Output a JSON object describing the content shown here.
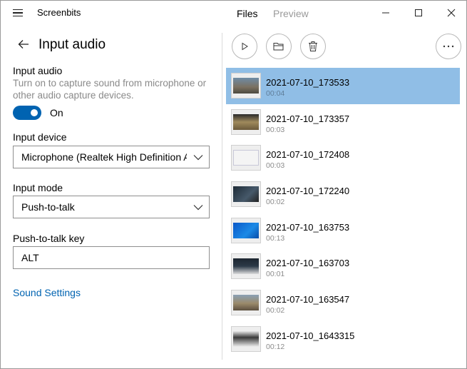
{
  "app": {
    "title": "Screenbits"
  },
  "nav": {
    "files": "Files",
    "preview": "Preview"
  },
  "panel": {
    "title": "Input audio",
    "input_audio_label": "Input audio",
    "input_audio_description": "Turn on to capture sound from microphone or other audio capture devices.",
    "toggle_state": "On",
    "input_device_label": "Input device",
    "input_device_value": "Microphone (Realtek High Definition Audio)",
    "input_mode_label": "Input mode",
    "input_mode_value": "Push-to-talk",
    "ptt_key_label": "Push-to-talk key",
    "ptt_key_value": "ALT",
    "sound_settings_link": "Sound Settings"
  },
  "colors": {
    "accent": "#0063b1",
    "selection": "#90bee6"
  },
  "toolbar": {
    "icons": [
      "play-icon",
      "folder-icon",
      "delete-icon",
      "more-icon"
    ]
  },
  "files": [
    {
      "name": "2021-07-10_173533",
      "duration": "00:04",
      "selected": true
    },
    {
      "name": "2021-07-10_173357",
      "duration": "00:03",
      "selected": false
    },
    {
      "name": "2021-07-10_172408",
      "duration": "00:03",
      "selected": false
    },
    {
      "name": "2021-07-10_172240",
      "duration": "00:02",
      "selected": false
    },
    {
      "name": "2021-07-10_163753",
      "duration": "00:13",
      "selected": false
    },
    {
      "name": "2021-07-10_163703",
      "duration": "00:01",
      "selected": false
    },
    {
      "name": "2021-07-10_163547",
      "duration": "00:02",
      "selected": false
    },
    {
      "name": "2021-07-10_1643315",
      "duration": "00:12",
      "selected": false
    }
  ]
}
